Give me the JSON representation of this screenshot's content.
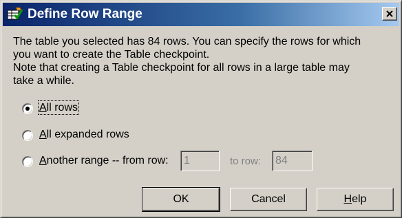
{
  "dialog": {
    "title": "Define Row Range",
    "title_icon": "table-checkpoint-icon",
    "close_icon": "close-icon"
  },
  "message": {
    "line1": "The table you selected has 84  rows. You can specify the rows for which",
    "line2": "you want to create the Table checkpoint.",
    "line3": "Note that creating a Table checkpoint for all rows in a large table may",
    "line4": "take a while."
  },
  "options": {
    "all_rows": {
      "label": "All rows",
      "selected": true
    },
    "all_expanded": {
      "label": "All expanded rows",
      "selected": false
    },
    "another_range": {
      "label": "Another range -- from row:",
      "selected": false,
      "from_value": "1",
      "to_label": "to row:",
      "to_value": "84"
    }
  },
  "buttons": {
    "ok": "OK",
    "cancel": "Cancel",
    "help": "Help"
  }
}
